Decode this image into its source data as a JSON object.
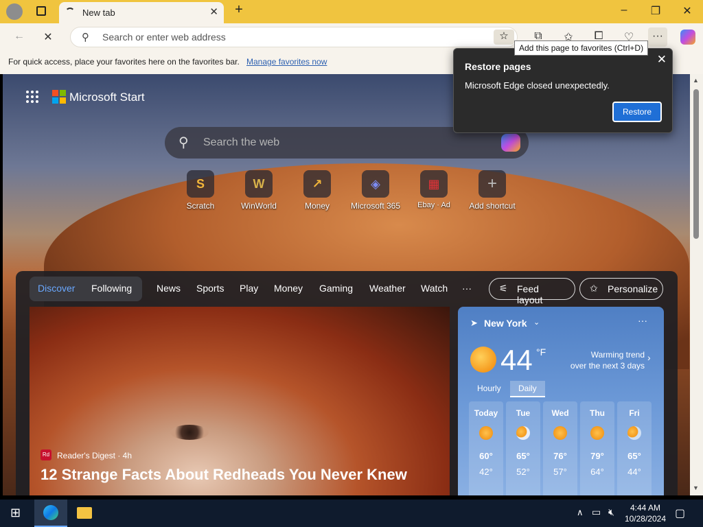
{
  "browser": {
    "tab_title": "New tab",
    "address_placeholder": "Search or enter web address",
    "tooltip": "Add this page to favorites (Ctrl+D)",
    "favorites_message": "For quick access, place your favorites here on the favorites bar.",
    "favorites_link": "Manage favorites now"
  },
  "restore_popup": {
    "title": "Restore pages",
    "message": "Microsoft Edge closed unexpectedly.",
    "button": "Restore"
  },
  "start": {
    "brand": "Microsoft Start",
    "search_placeholder": "Search the web",
    "shortcuts": [
      {
        "label": "Scratch",
        "glyph": "S"
      },
      {
        "label": "WinWorld",
        "glyph": "W"
      },
      {
        "label": "Money",
        "glyph": "↗"
      },
      {
        "label": "Microsoft 365",
        "glyph": "◈"
      },
      {
        "label": "Ebay · Ad",
        "glyph": "▦"
      },
      {
        "label": "Add shortcut",
        "glyph": "+"
      }
    ]
  },
  "feed": {
    "tabs": [
      "Discover",
      "Following",
      "News",
      "Sports",
      "Play",
      "Money",
      "Gaming",
      "Weather",
      "Watch",
      "···"
    ],
    "feed_layout": "Feed layout",
    "personalize": "Personalize",
    "hero": {
      "source_badge": "Rd",
      "source": "Reader's Digest · 4h",
      "headline": "12 Strange Facts About Redheads You Never Knew"
    }
  },
  "weather": {
    "location": "New York",
    "temperature": "44",
    "unit": "°F",
    "trend_line1": "Warming trend",
    "trend_line2": "over the next 3 days",
    "tab_hourly": "Hourly",
    "tab_daily": "Daily",
    "days": [
      {
        "name": "Today",
        "high": "60°",
        "low": "42°"
      },
      {
        "name": "Tue",
        "high": "65°",
        "low": "52°"
      },
      {
        "name": "Wed",
        "high": "76°",
        "low": "57°"
      },
      {
        "name": "Thu",
        "high": "79°",
        "low": "64°"
      },
      {
        "name": "Fri",
        "high": "65°",
        "low": "44°"
      }
    ]
  },
  "taskbar": {
    "time": "4:44 AM",
    "date": "10/28/2024"
  },
  "colors": {
    "titlebar": "#f0c43f",
    "accent": "#1f6fd6",
    "taskbar": "#0f1b2d"
  }
}
